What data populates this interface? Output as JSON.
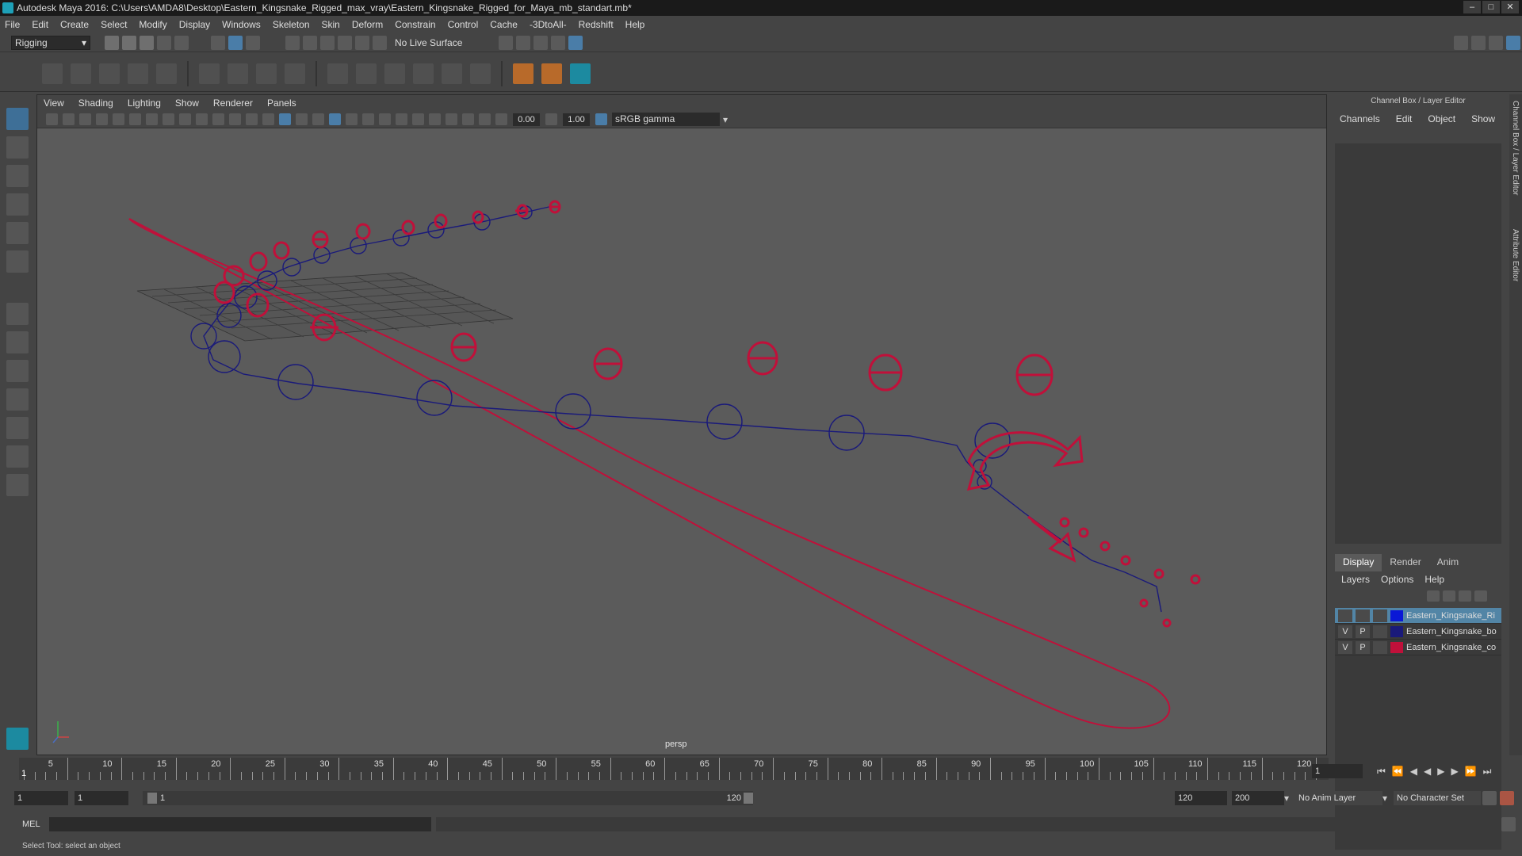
{
  "window": {
    "title": "Autodesk Maya 2016: C:\\Users\\AMDA8\\Desktop\\Eastern_Kingsnake_Rigged_max_vray\\Eastern_Kingsnake_Rigged_for_Maya_mb_standart.mb*"
  },
  "menubar": [
    "File",
    "Edit",
    "Create",
    "Select",
    "Modify",
    "Display",
    "Windows",
    "Skeleton",
    "Skin",
    "Deform",
    "Constrain",
    "Control",
    "Cache",
    "-3DtoAll-",
    "Redshift",
    "Help"
  ],
  "statusline": {
    "mode": "Rigging",
    "live_surface": "No Live Surface"
  },
  "viewport": {
    "menus": [
      "View",
      "Shading",
      "Lighting",
      "Show",
      "Renderer",
      "Panels"
    ],
    "exposure": "0.00",
    "gamma_value": "1.00",
    "colorspace": "sRGB gamma",
    "camera": "persp"
  },
  "channelbox": {
    "title": "Channel Box / Layer Editor",
    "tabs": [
      "Channels",
      "Edit",
      "Object",
      "Show"
    ]
  },
  "layer_editor": {
    "tabs": [
      "Display",
      "Render",
      "Anim"
    ],
    "menus": [
      "Layers",
      "Options",
      "Help"
    ],
    "layers": [
      {
        "v": "",
        "p": "",
        "name": "Eastern_Kingsnake_Ri",
        "color": "#0a18d6",
        "selected": true
      },
      {
        "v": "V",
        "p": "P",
        "name": "Eastern_Kingsnake_bo",
        "color": "#1a1a7a",
        "selected": false
      },
      {
        "v": "V",
        "p": "P",
        "name": "Eastern_Kingsnake_co",
        "color": "#c0103a",
        "selected": false
      }
    ]
  },
  "sidetabs": [
    "Channel Box / Layer Editor",
    "Attribute Editor"
  ],
  "timeline": {
    "start": 1,
    "end": 120,
    "tick_labels": [
      "5",
      "10",
      "15",
      "20",
      "25",
      "30",
      "35",
      "40",
      "45",
      "50",
      "55",
      "60",
      "65",
      "70",
      "75",
      "80",
      "85",
      "90",
      "95",
      "100",
      "105",
      "110",
      "115",
      "120"
    ],
    "current_frame": "1",
    "current_marker": "1"
  },
  "range": {
    "start_field": "1",
    "start_field2": "1",
    "slider_start": "1",
    "slider_end": "120",
    "end_field": "120",
    "end_field2": "200",
    "anim_layer": "No Anim Layer",
    "character_set": "No Character Set"
  },
  "cmdline": {
    "label": "MEL"
  },
  "help_line": "Select Tool: select an object"
}
